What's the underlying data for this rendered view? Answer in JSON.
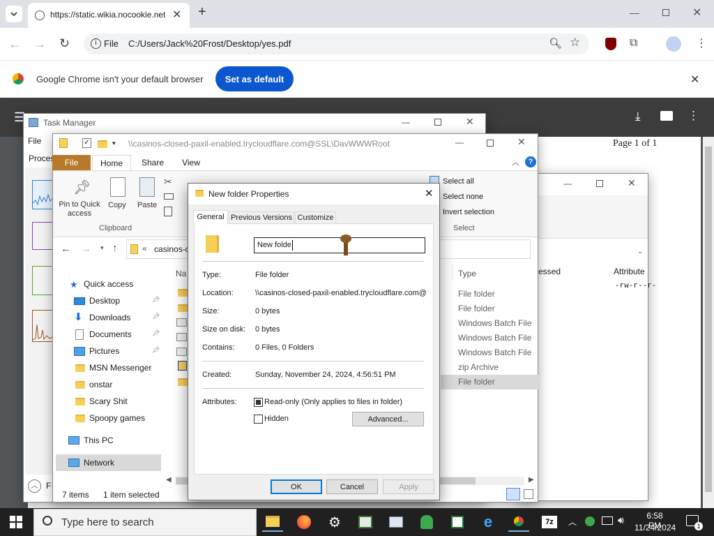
{
  "browser": {
    "tab_title": "https://static.wikia.nocookie.net",
    "new_tab": "+",
    "omnibox_label": "File",
    "url": "C:/Users/Jack%20Frost/Desktop/yes.pdf",
    "infobar_text": "Google Chrome isn't your default browser",
    "set_default": "Set as default"
  },
  "pdf": {
    "page_indicator": "Page 1 of 1"
  },
  "task_manager": {
    "title": "Task Manager",
    "menu_file": "File",
    "tab_processes": "Proces",
    "more_details": "F"
  },
  "explorer": {
    "title_path": "\\\\casinos-closed-paxil-enabled.trycloudflare.com@SSL\\DavWWWRoot",
    "tabs": [
      "File",
      "Home",
      "Share",
      "View"
    ],
    "clipboard": {
      "pin": "Pin to Quick access",
      "copy": "Copy",
      "paste": "Paste",
      "group": "Clipboard"
    },
    "select": {
      "all": "Select all",
      "none": "Select none",
      "invert": "Invert selection",
      "group": "Select"
    },
    "address_fragment": "casinos-c",
    "nav": {
      "quick_access": "Quick access",
      "items": [
        "Desktop",
        "Downloads",
        "Documents",
        "Pictures",
        "MSN Messenger",
        "onstar",
        "Scary Shit",
        "Spoopy games"
      ],
      "this_pc": "This PC",
      "network": "Network"
    },
    "col_name": "Na",
    "col_type": "Type",
    "types": [
      "File folder",
      "File folder",
      "Windows Batch File",
      "Windows Batch File",
      "Windows Batch File",
      "zip Archive",
      "File folder"
    ],
    "status_items": "7 items",
    "status_selected": "1 item selected"
  },
  "third_window": {
    "col_pressed": "essed",
    "col_attributes": "Attribute",
    "attr_value": "-rw-r--r-"
  },
  "dialog": {
    "title": "New folder Properties",
    "tabs": [
      "General",
      "Previous Versions",
      "Customize"
    ],
    "name_value": "New folde",
    "type_label": "Type:",
    "type_value": "File folder",
    "location_label": "Location:",
    "location_value": "\\\\casinos-closed-paxil-enabled.trycloudflare.com@",
    "size_label": "Size:",
    "size_value": "0 bytes",
    "sizeondisk_label": "Size on disk:",
    "sizeondisk_value": "0 bytes",
    "contains_label": "Contains:",
    "contains_value": "0 Files, 0 Folders",
    "created_label": "Created:",
    "created_value": "Sunday, November 24, 2024, 4:56:51 PM",
    "attributes_label": "Attributes:",
    "readonly_label": "Read-only (Only applies to files in folder)",
    "hidden_label": "Hidden",
    "advanced": "Advanced...",
    "ok": "OK",
    "cancel": "Cancel",
    "apply": "Apply"
  },
  "taskbar": {
    "search_placeholder": "Type here to search",
    "time": "6:58 PM",
    "date": "11/24/2024",
    "notif_count": "1"
  },
  "colors": {
    "chrome_blue": "#0b57d0",
    "ribbon_file": "#b87a2a",
    "taskbar": "#202020"
  }
}
